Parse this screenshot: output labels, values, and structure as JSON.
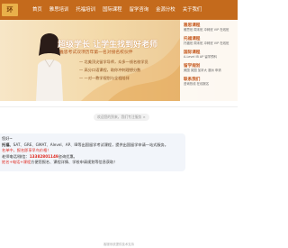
{
  "nav": {
    "logo_text": "环",
    "items": [
      "首页",
      "雅思培训",
      "托福培训",
      "国际课程",
      "留学咨询",
      "金源分校",
      "关于我们"
    ]
  },
  "banner": {
    "headline": "超级学长 让学生找到好老师",
    "subline": "雅思考试双项历年第一名对接名校伙伴",
    "bullets": [
      "— 北美顶尖留学导师，众多一线名校学员",
      "— 高分口语课程，助你冲刺理想分数",
      "— 一对一教学规划与全程陪伴"
    ]
  },
  "right_panel": {
    "blocks": [
      {
        "title": "雅思课程",
        "lines": [
          "雅思班 周末班 冲刺班 VIP 在线班"
        ]
      },
      {
        "title": "托福课程",
        "lines": [
          "托福班 周末班 冲刺班 VIP 在线班"
        ]
      },
      {
        "title": "国际课程",
        "lines": [
          "A-Level IB AP 留学预科"
        ]
      },
      {
        "title": "留学规划",
        "lines": [
          "美国 英国 加拿大 澳洲 申请"
        ]
      },
      {
        "title": "联系我们",
        "lines": [
          "咨询热线 在线报名"
        ]
      }
    ]
  },
  "notice": "欢迎您的到来，我们专注服务 ×",
  "message": {
    "greeting": "您好~",
    "services_prefix": "托福、",
    "services": "SAT、GRE、GMAT、Alevel、AP、IB等出国留学考试课程，提供出国留学申请一站式服务。",
    "promo": "名单中，报名即享早鸟价格！",
    "phone_prefix": "老师电话/微信：",
    "phone": "13382801149",
    "phone_suffix": "咨询优惠。",
    "cta_red": "姓名+电话+课程",
    "cta_suffix": "方便您报名、课程详情、学校申请规划等信息获取！"
  },
  "footer": "客服系统提供技术支持",
  "colors": {
    "brand": "#c46a1c",
    "accent_red": "#e0281e"
  }
}
